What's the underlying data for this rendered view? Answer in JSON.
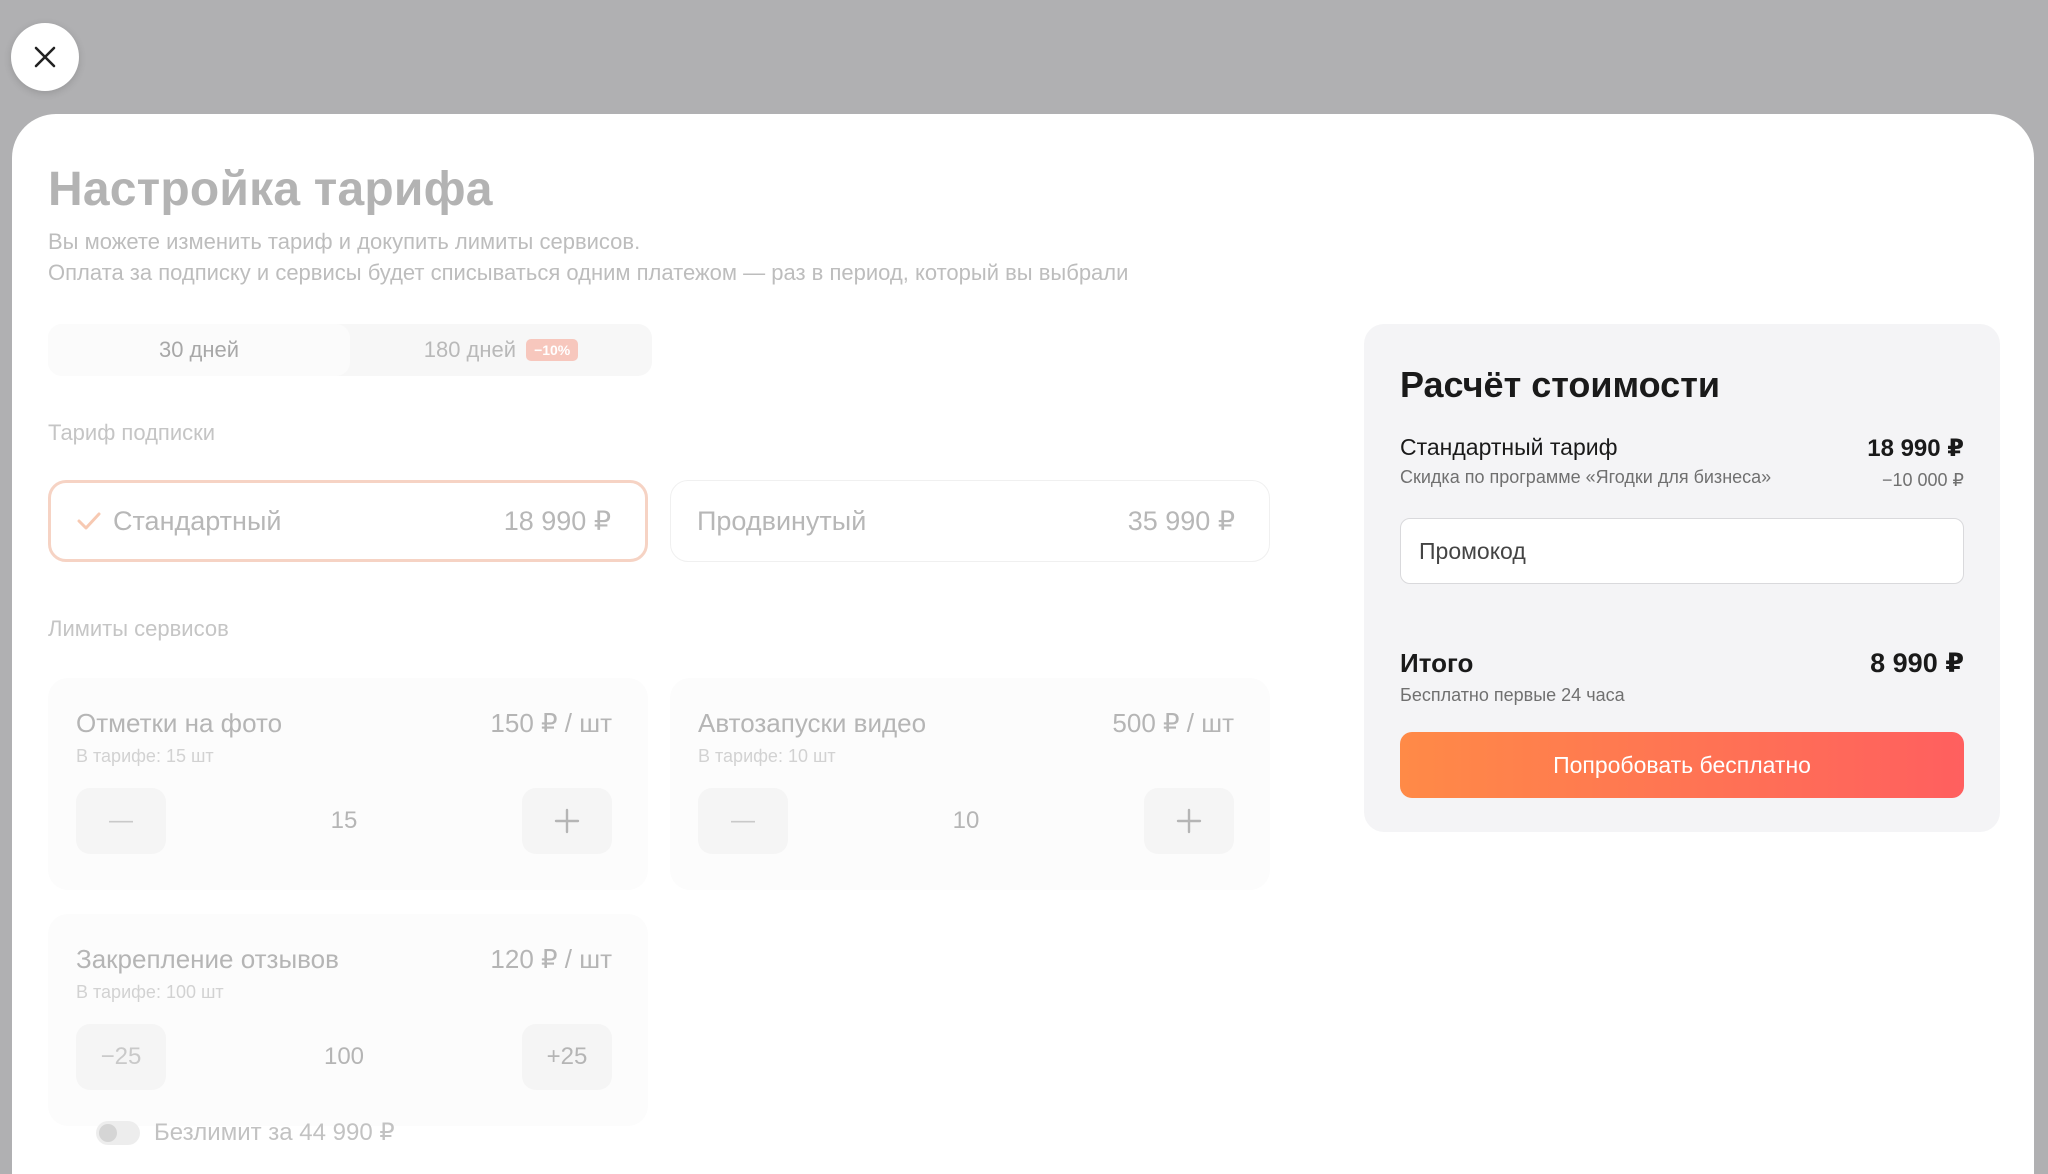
{
  "close": {
    "icon": "close-icon"
  },
  "header": {
    "title": "Настройка тарифа",
    "subtitle_line1": "Вы можете изменить тариф и докупить лимиты сервисов.",
    "subtitle_line2": "Оплата за подписку и сервисы будет списываться одним платежом — раз в период, который вы выбрали"
  },
  "period": {
    "tabs": [
      {
        "label": "30 дней",
        "active": true
      },
      {
        "label": "180 дней",
        "badge": "−10%"
      }
    ]
  },
  "plans": {
    "label": "Тариф подписки",
    "items": [
      {
        "name": "Стандартный",
        "price": "18 990 ₽",
        "selected": true
      },
      {
        "name": "Продвинутый",
        "price": "35 990 ₽"
      }
    ]
  },
  "services": {
    "label": "Лимиты сервисов",
    "items": [
      {
        "title": "Отметки на фото",
        "price": "150 ₽ / шт",
        "included": "В тарифе: 15 шт",
        "minus": "—",
        "value": "15",
        "plus": "+"
      },
      {
        "title": "Автозапуски видео",
        "price": "500 ₽ / шт",
        "included": "В тарифе: 10 шт",
        "minus": "—",
        "value": "10",
        "plus": "+"
      },
      {
        "title": "Закрепление отзывов",
        "price": "120 ₽ / шт",
        "included": "В тарифе: 100 шт",
        "minus": "−25",
        "value": "100",
        "plus": "+25"
      }
    ],
    "unlimited_label": "Безлимит за 44 990 ₽"
  },
  "summary": {
    "title": "Расчёт стоимости",
    "plan_label": "Стандартный тариф",
    "plan_price": "18 990 ₽",
    "discount_label": "Скидка по программе «Ягодки для бизнеса»",
    "discount_value": "−10 000 ₽",
    "promo_placeholder": "Промокод",
    "total_label": "Итого",
    "total_value": "8 990 ₽",
    "total_note": "Бесплатно первые 24 часа",
    "cta_label": "Попробовать бесплатно"
  },
  "colors": {
    "accent_start": "#ff8a47",
    "accent_end": "#ff5f5f",
    "selected_border": "#f6d3c4"
  }
}
